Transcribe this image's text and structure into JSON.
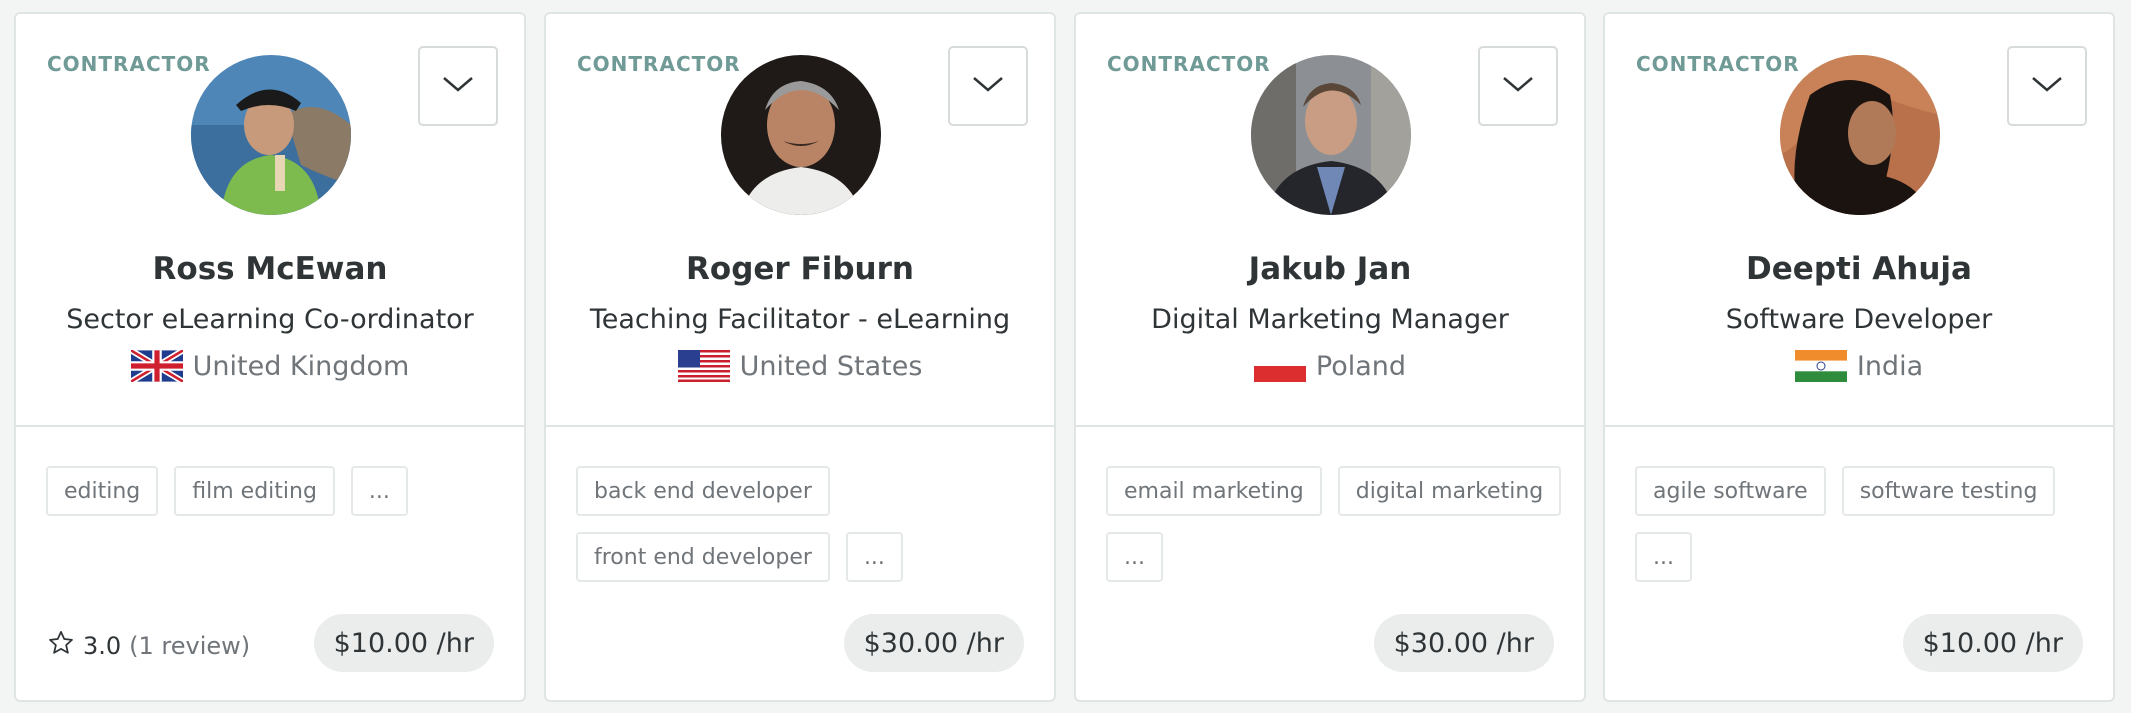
{
  "cards": [
    {
      "type": "CONTRACTOR",
      "name": "Ross McEwan",
      "title": "Sector eLearning Co-ordinator",
      "country": "United Kingdom",
      "flag": "flag-uk",
      "skills": [
        "editing",
        "film editing"
      ],
      "more": "...",
      "rating": "3.0",
      "reviews": "(1 review)",
      "rate": "$10.00 /hr"
    },
    {
      "type": "CONTRACTOR",
      "name": "Roger Fiburn",
      "title": "Teaching Facilitator - eLearning",
      "country": "United States",
      "flag": "flag-us",
      "skills": [
        "back end developer",
        "front end developer"
      ],
      "more": "...",
      "rate": "$30.00 /hr"
    },
    {
      "type": "CONTRACTOR",
      "name": "Jakub Jan",
      "title": "Digital Marketing Manager",
      "country": "Poland",
      "flag": "flag-poland",
      "skills": [
        "email marketing",
        "digital marketing"
      ],
      "more": "...",
      "rate": "$30.00 /hr"
    },
    {
      "type": "CONTRACTOR",
      "name": "Deepti Ahuja",
      "title": "Software Developer",
      "country": "India",
      "flag": "flag-india",
      "skills": [
        "agile software",
        "software testing"
      ],
      "more": "...",
      "rate": "$10.00 /hr"
    }
  ]
}
